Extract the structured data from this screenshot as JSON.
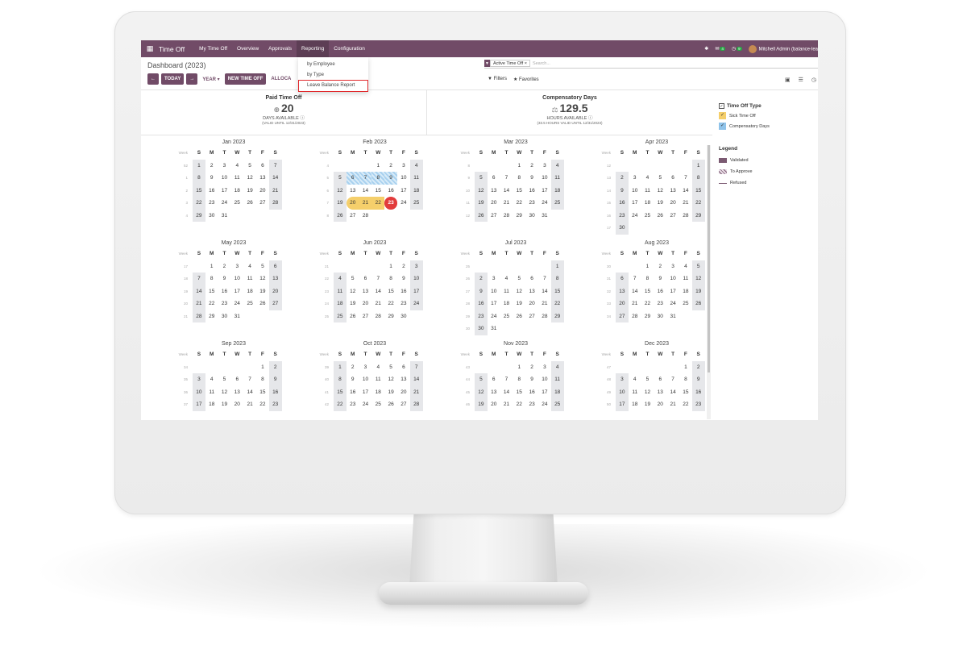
{
  "nav": {
    "app": "Time Off",
    "items": [
      "My Time Off",
      "Overview",
      "Approvals",
      "Reporting",
      "Configuration"
    ],
    "active": "Reporting",
    "badge1": "4",
    "badge2": "9",
    "user": "Mitchell Admin (balance-lea"
  },
  "control": {
    "title": "Dashboard (2023)",
    "prev": "←",
    "today": "TODAY",
    "next": "→",
    "year": "YEAR ▾",
    "new": "NEW TIME OFF",
    "alloc": "ALLOCA",
    "facet": "Active Time Off",
    "facet_close": "×",
    "search_placeholder": "Search...",
    "filters": "Filters",
    "favorites": "Favorites"
  },
  "dropdown": [
    "by Employee",
    "by Type",
    "Leave Balance Report"
  ],
  "summary": [
    {
      "title": "Paid Time Off",
      "value": "20",
      "sub": "DAYS AVAILABLE",
      "sub2": "(VALID UNTIL 12/31/2023)"
    },
    {
      "title": "Compensatory Days",
      "value": "129.5",
      "sub": "HOURS AVAILABLE",
      "sub2": "(33.5 HOURS VALID UNTIL 12/31/2023)"
    }
  ],
  "sidebar": {
    "type_header": "Time Off Type",
    "types": [
      {
        "label": "Sick Time Off",
        "color": "#f5cf6b"
      },
      {
        "label": "Compensatory Days",
        "color": "#8fc3ea"
      }
    ],
    "legend_header": "Legend",
    "legend": [
      {
        "label": "Validated"
      },
      {
        "label": "To Approve"
      },
      {
        "label": "Refused"
      }
    ]
  },
  "calendar": {
    "week_label": "Week",
    "day_headers": [
      "S",
      "M",
      "T",
      "W",
      "T",
      "F",
      "S"
    ],
    "months": [
      {
        "name": "Jan 2023",
        "weeks": [
          "52",
          "1",
          "2",
          "3",
          "4"
        ],
        "rows": [
          [
            "",
            "1",
            "2",
            "3",
            "4",
            "5",
            "6",
            "7"
          ],
          [
            "",
            "8",
            "9",
            "10",
            "11",
            "12",
            "13",
            "14"
          ],
          [
            "",
            "15",
            "16",
            "17",
            "18",
            "19",
            "20",
            "21"
          ],
          [
            "",
            "22",
            "23",
            "24",
            "25",
            "26",
            "27",
            "28"
          ],
          [
            "",
            "29",
            "30",
            "31",
            "",
            "",
            "",
            ""
          ]
        ]
      },
      {
        "name": "Feb 2023",
        "weeks": [
          "4",
          "5",
          "6",
          "7",
          "8"
        ],
        "rows": [
          [
            "",
            "",
            "",
            "",
            "1",
            "2",
            "3",
            "4"
          ],
          [
            "",
            "5",
            "6",
            "7",
            "8",
            "9",
            "10",
            "11"
          ],
          [
            "",
            "12",
            "13",
            "14",
            "15",
            "16",
            "17",
            "18"
          ],
          [
            "",
            "19",
            "20",
            "21",
            "22",
            "23",
            "24",
            "25"
          ],
          [
            "",
            "26",
            "27",
            "28",
            "",
            "",
            "",
            ""
          ]
        ]
      },
      {
        "name": "Mar 2023",
        "weeks": [
          "8",
          "9",
          "10",
          "11",
          "12"
        ],
        "rows": [
          [
            "",
            "",
            "",
            "",
            "1",
            "2",
            "3",
            "4"
          ],
          [
            "",
            "5",
            "6",
            "7",
            "8",
            "9",
            "10",
            "11"
          ],
          [
            "",
            "12",
            "13",
            "14",
            "15",
            "16",
            "17",
            "18"
          ],
          [
            "",
            "19",
            "20",
            "21",
            "22",
            "23",
            "24",
            "25"
          ],
          [
            "",
            "26",
            "27",
            "28",
            "29",
            "30",
            "31",
            ""
          ]
        ]
      },
      {
        "name": "Apr 2023",
        "weeks": [
          "12",
          "13",
          "14",
          "15",
          "16",
          "17"
        ],
        "rows": [
          [
            "",
            "",
            "",
            "",
            "",
            "",
            "",
            "1"
          ],
          [
            "",
            "2",
            "3",
            "4",
            "5",
            "6",
            "7",
            "8"
          ],
          [
            "",
            "9",
            "10",
            "11",
            "12",
            "13",
            "14",
            "15"
          ],
          [
            "",
            "16",
            "17",
            "18",
            "19",
            "20",
            "21",
            "22"
          ],
          [
            "",
            "23",
            "24",
            "25",
            "26",
            "27",
            "28",
            "29"
          ],
          [
            "",
            "30",
            "",
            "",
            "",
            "",
            "",
            ""
          ]
        ]
      },
      {
        "name": "May 2023",
        "weeks": [
          "17",
          "18",
          "19",
          "20",
          "21"
        ],
        "rows": [
          [
            "",
            "",
            "1",
            "2",
            "3",
            "4",
            "5",
            "6"
          ],
          [
            "",
            "7",
            "8",
            "9",
            "10",
            "11",
            "12",
            "13"
          ],
          [
            "",
            "14",
            "15",
            "16",
            "17",
            "18",
            "19",
            "20"
          ],
          [
            "",
            "21",
            "22",
            "23",
            "24",
            "25",
            "26",
            "27"
          ],
          [
            "",
            "28",
            "29",
            "30",
            "31",
            "",
            "",
            ""
          ]
        ]
      },
      {
        "name": "Jun 2023",
        "weeks": [
          "21",
          "22",
          "23",
          "24",
          "25"
        ],
        "rows": [
          [
            "",
            "",
            "",
            "",
            "",
            "1",
            "2",
            "3"
          ],
          [
            "",
            "4",
            "5",
            "6",
            "7",
            "8",
            "9",
            "10"
          ],
          [
            "",
            "11",
            "12",
            "13",
            "14",
            "15",
            "16",
            "17"
          ],
          [
            "",
            "18",
            "19",
            "20",
            "21",
            "22",
            "23",
            "24"
          ],
          [
            "",
            "25",
            "26",
            "27",
            "28",
            "29",
            "30",
            ""
          ]
        ]
      },
      {
        "name": "Jul 2023",
        "weeks": [
          "25",
          "26",
          "27",
          "28",
          "29",
          "30"
        ],
        "rows": [
          [
            "",
            "",
            "",
            "",
            "",
            "",
            "",
            "1"
          ],
          [
            "",
            "2",
            "3",
            "4",
            "5",
            "6",
            "7",
            "8"
          ],
          [
            "",
            "9",
            "10",
            "11",
            "12",
            "13",
            "14",
            "15"
          ],
          [
            "",
            "16",
            "17",
            "18",
            "19",
            "20",
            "21",
            "22"
          ],
          [
            "",
            "23",
            "24",
            "25",
            "26",
            "27",
            "28",
            "29"
          ],
          [
            "",
            "30",
            "31",
            "",
            "",
            "",
            "",
            ""
          ]
        ]
      },
      {
        "name": "Aug 2023",
        "weeks": [
          "30",
          "31",
          "32",
          "33",
          "34"
        ],
        "rows": [
          [
            "",
            "",
            "",
            "1",
            "2",
            "3",
            "4",
            "5"
          ],
          [
            "",
            "6",
            "7",
            "8",
            "9",
            "10",
            "11",
            "12"
          ],
          [
            "",
            "13",
            "14",
            "15",
            "16",
            "17",
            "18",
            "19"
          ],
          [
            "",
            "20",
            "21",
            "22",
            "23",
            "24",
            "25",
            "26"
          ],
          [
            "",
            "27",
            "28",
            "29",
            "30",
            "31",
            "",
            ""
          ]
        ]
      },
      {
        "name": "Sep 2023",
        "weeks": [
          "34",
          "35",
          "36",
          "37"
        ],
        "rows": [
          [
            "",
            "",
            "",
            "",
            "",
            "",
            "1",
            "2"
          ],
          [
            "",
            "3",
            "4",
            "5",
            "6",
            "7",
            "8",
            "9"
          ],
          [
            "",
            "10",
            "11",
            "12",
            "13",
            "14",
            "15",
            "16"
          ],
          [
            "",
            "17",
            "18",
            "19",
            "20",
            "21",
            "22",
            "23"
          ]
        ]
      },
      {
        "name": "Oct 2023",
        "weeks": [
          "39",
          "40",
          "41",
          "42"
        ],
        "rows": [
          [
            "",
            "1",
            "2",
            "3",
            "4",
            "5",
            "6",
            "7"
          ],
          [
            "",
            "8",
            "9",
            "10",
            "11",
            "12",
            "13",
            "14"
          ],
          [
            "",
            "15",
            "16",
            "17",
            "18",
            "19",
            "20",
            "21"
          ],
          [
            "",
            "22",
            "23",
            "24",
            "25",
            "26",
            "27",
            "28"
          ]
        ]
      },
      {
        "name": "Nov 2023",
        "weeks": [
          "43",
          "44",
          "45",
          "46"
        ],
        "rows": [
          [
            "",
            "",
            "",
            "",
            "1",
            "2",
            "3",
            "4"
          ],
          [
            "",
            "5",
            "6",
            "7",
            "8",
            "9",
            "10",
            "11"
          ],
          [
            "",
            "12",
            "13",
            "14",
            "15",
            "16",
            "17",
            "18"
          ],
          [
            "",
            "19",
            "20",
            "21",
            "22",
            "23",
            "24",
            "25"
          ]
        ]
      },
      {
        "name": "Dec 2023",
        "weeks": [
          "47",
          "48",
          "49",
          "50"
        ],
        "rows": [
          [
            "",
            "",
            "",
            "",
            "",
            "",
            "1",
            "2"
          ],
          [
            "",
            "3",
            "4",
            "5",
            "6",
            "7",
            "8",
            "9"
          ],
          [
            "",
            "10",
            "11",
            "12",
            "13",
            "14",
            "15",
            "16"
          ],
          [
            "",
            "17",
            "18",
            "19",
            "20",
            "21",
            "22",
            "23"
          ]
        ]
      }
    ],
    "hatch_days": {
      "Feb 2023": [
        "6",
        "7",
        "8",
        "9"
      ]
    },
    "yellow_days": {
      "Feb 2023": [
        "20",
        "21",
        "22"
      ]
    },
    "today": {
      "month": "Feb 2023",
      "day": "23"
    }
  }
}
